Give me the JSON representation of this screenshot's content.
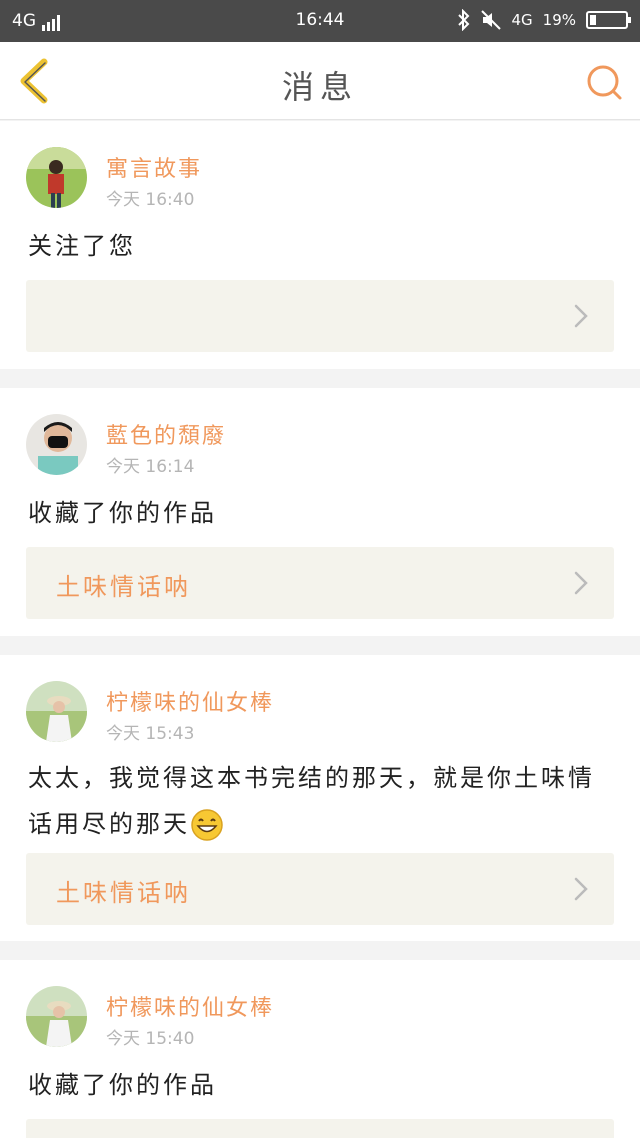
{
  "status_bar": {
    "network": "4G",
    "time": "16:44",
    "network2": "4G",
    "battery": "19%",
    "battery_level": 0.19
  },
  "header": {
    "title": "消息"
  },
  "colors": {
    "accent": "#f0985c",
    "status_bar_bg": "#4a4a4a",
    "link_box_bg": "#f4f3ec"
  },
  "messages": [
    {
      "username": "寓言故事",
      "time": "今天 16:40",
      "text": "关注了您",
      "link": ""
    },
    {
      "username": "藍色的頹廢",
      "time": "今天 16:14",
      "text": "收藏了你的作品",
      "link": "土味情话呐"
    },
    {
      "username": "柠檬味的仙女棒",
      "time": "今天 15:43",
      "text": "太太，我觉得这本书完结的那天，就是你土味情话用尽的那天",
      "emoji": "grinning-face-icon",
      "link": "土味情话呐"
    },
    {
      "username": "柠檬味的仙女棒",
      "time": "今天 15:40",
      "text": "收藏了你的作品",
      "link": ""
    }
  ]
}
